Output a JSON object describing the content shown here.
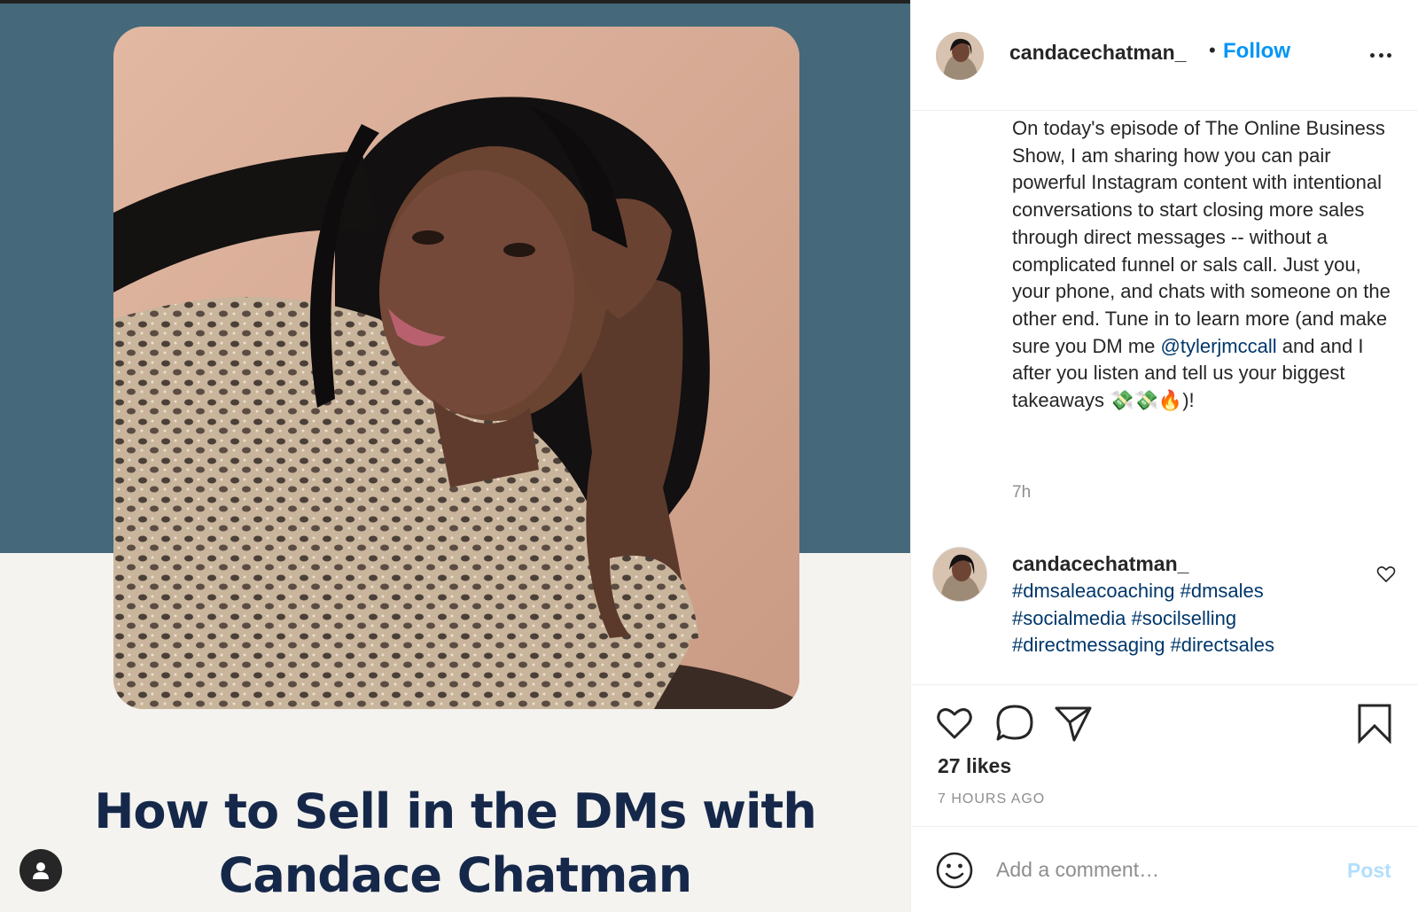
{
  "media": {
    "headline_line1": "How to Sell in the DMs with",
    "headline_line2": "Candace Chatman",
    "user_tag_icon": "user-icon"
  },
  "header": {
    "username": "candacechatman_",
    "separator": "•",
    "follow_label": "Follow",
    "more_icon": "more-options-icon"
  },
  "caption": {
    "text_before_mention": "On today's episode of The Online Business Show, I am sharing how you can pair powerful Instagram content with intentional conversations to start closing more sales through direct messages -- without a complicated funnel or sals call. Just you, your phone, and chats with someone on the other end. Tune in to learn more (and make sure you DM me ",
    "mention": "@tylerjmccall",
    "text_after_mention": " and and I after you listen and tell us your biggest takeaways 💸💸🔥)!",
    "time": "7h"
  },
  "comment": {
    "username": "candacechatman_",
    "hashtags": [
      "#dmsaleacoaching",
      "#dmsales",
      "#socialmedia",
      "#socilselling",
      "#directmessaging",
      "#directsales"
    ]
  },
  "actions": {
    "likes": "27 likes",
    "date": "7 HOURS AGO"
  },
  "add_comment": {
    "placeholder": "Add a comment…",
    "post_label": "Post"
  },
  "colors": {
    "accent": "#0095f6",
    "link": "#00376b",
    "media_blue": "#45697a",
    "headline": "#16284a"
  }
}
